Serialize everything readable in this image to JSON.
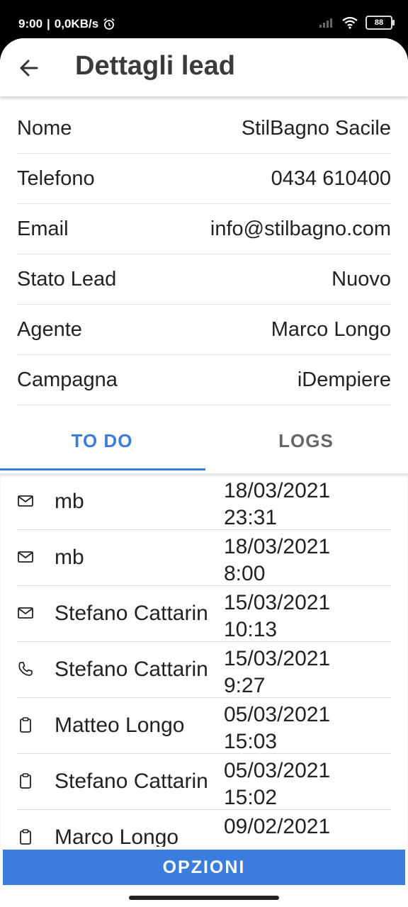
{
  "status_bar": {
    "time": "9:00",
    "speed": "0,0KB/s",
    "battery": "88"
  },
  "app_bar": {
    "title": "Dettagli lead"
  },
  "details": [
    {
      "label": "Nome",
      "value": "StilBagno Sacile"
    },
    {
      "label": "Telefono",
      "value": "0434 610400"
    },
    {
      "label": "Email",
      "value": "info@stilbagno.com"
    },
    {
      "label": "Stato Lead",
      "value": "Nuovo"
    },
    {
      "label": "Agente",
      "value": "Marco Longo"
    },
    {
      "label": "Campagna",
      "value": "iDempiere"
    }
  ],
  "tabs": [
    {
      "label": "TO DO",
      "active": true
    },
    {
      "label": "LOGS",
      "active": false
    }
  ],
  "todo_items": [
    {
      "icon": "mail-icon",
      "name": "mb",
      "date": "18/03/2021",
      "time": "23:31"
    },
    {
      "icon": "mail-icon",
      "name": "mb",
      "date": "18/03/2021",
      "time": "8:00"
    },
    {
      "icon": "mail-icon",
      "name": "Stefano Cattarin",
      "date": "15/03/2021",
      "time": "10:13"
    },
    {
      "icon": "phone-icon",
      "name": "Stefano Cattarin",
      "date": "15/03/2021",
      "time": "9:27"
    },
    {
      "icon": "clipboard-icon",
      "name": "Matteo Longo",
      "date": "05/03/2021",
      "time": "15:03"
    },
    {
      "icon": "clipboard-icon",
      "name": "Stefano Cattarin",
      "date": "05/03/2021",
      "time": "15:02"
    },
    {
      "icon": "clipboard-icon",
      "name": "Marco Longo",
      "date": "09/02/2021",
      "time": ""
    }
  ],
  "options_button": {
    "label": "OPZIONI"
  },
  "colors": {
    "accent": "#3b7ddd",
    "text": "#222222",
    "divider": "#e2e2e2"
  }
}
